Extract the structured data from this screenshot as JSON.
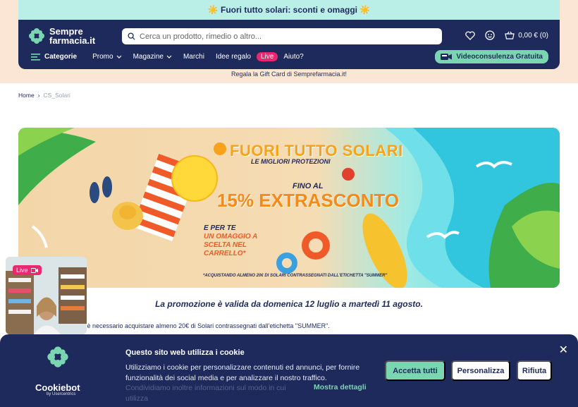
{
  "promo_strip": {
    "text": "☀️ Fuori tutto solari: sconti e omaggi ☀️"
  },
  "header": {
    "logo_line1": "Sempre",
    "logo_line2": "farmacia.it",
    "search_placeholder": "Cerca un prodotto, rimedio o altro...",
    "cart_label": "0,00 € (0)"
  },
  "nav": {
    "categories": "Categorie",
    "promo": "Promo",
    "magazine": "Magazine",
    "marchi": "Marchi",
    "idee_regalo": "Idee regalo",
    "live": "Live",
    "aiuto": "Aiuto?",
    "video_button": "Videoconsulenza Gratuita"
  },
  "gift_card": "Regala la Gift Card di Sempre​farmacia.it!",
  "breadcrumb": {
    "home": "Home",
    "current": "CS_Solari"
  },
  "banner": {
    "title": "FUORI TUTTO SOLARI",
    "subtitle": "LE MIGLIORI PROTEZIONI",
    "fino": "FINO AL",
    "discount": "15% EXTRASCONTO",
    "e_per_te": "E PER TE",
    "omaggio": "UN OMAGGIO A SCELTA NEL CARRELLO*",
    "note": "*ACQUISTANDO ALMENO 20€ DI SOLARI CONTRASSEGNATI DALL'ETICHETTA \"SUMMER\""
  },
  "promo_validity": "La promozione è valida da domenica 12 luglio a martedì 11 agosto.",
  "conditions": "o è necessario acquistare almeno 20€ di Solari contrassegnati dall'etichetta \"SUMMER\".",
  "live_video": {
    "badge": "Live"
  },
  "cookie": {
    "brand": "Cookiebot",
    "brand_sub": "by Usercentrics",
    "title": "Questo sito web utilizza i cookie",
    "text": "Utilizziamo i cookie per personalizzare contenuti ed annunci, per fornire funzionalità dei social media e per analizzare il nostro traffico.",
    "text_faded": "Condividiamo inoltre informazioni sul modo in cui utilizza",
    "more": "Mostra dettagli",
    "accept": "Accetta tutti",
    "customize": "Personalizza",
    "reject": "Rifiuta"
  },
  "colors": {
    "navy": "#1f2a5c",
    "mint": "#7ad6b0",
    "pink": "#e8286f",
    "promo_bg": "#b9efe6"
  }
}
